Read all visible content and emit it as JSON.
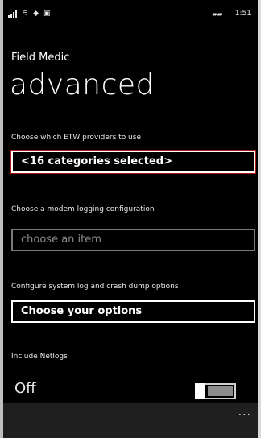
{
  "status": {
    "signal_glyph": "◆",
    "msg_glyph": "▣",
    "battery_glyph": "▰▰",
    "time": "1:51"
  },
  "app": {
    "title": "Field Medic",
    "page_title": "advanced"
  },
  "etw": {
    "label": "Choose which ETW providers to use",
    "value": "<16 categories selected>"
  },
  "modem": {
    "label": "Choose a modem logging configuration",
    "placeholder": "choose an item"
  },
  "syslog": {
    "label": "Configure system log and crash dump options",
    "value": "Choose your options"
  },
  "netlogs": {
    "label": "Include Netlogs",
    "state": "Off"
  },
  "appbar": {
    "more": "..."
  }
}
